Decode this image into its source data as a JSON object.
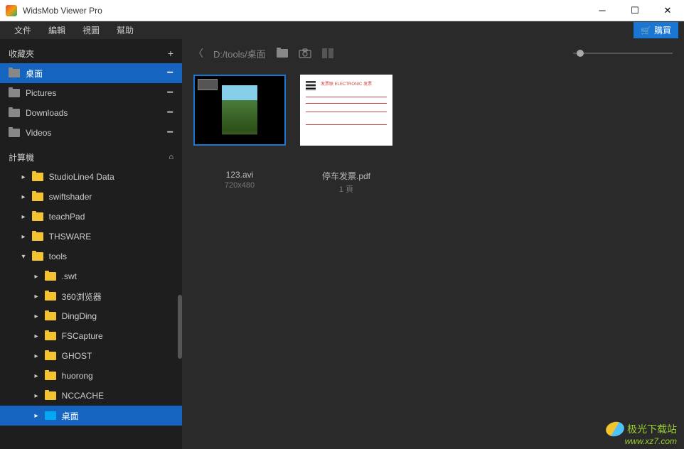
{
  "app": {
    "title": "WidsMob Viewer Pro"
  },
  "menubar": {
    "file": "文件",
    "edit": "編輯",
    "view": "視圖",
    "help": "幫助",
    "buy": "購買"
  },
  "sidebar": {
    "favorites_header": "收藏夾",
    "favorites": [
      {
        "label": "桌面",
        "active": true
      },
      {
        "label": "Pictures",
        "active": false
      },
      {
        "label": "Downloads",
        "active": false
      },
      {
        "label": "Videos",
        "active": false
      }
    ],
    "computer_header": "計算機",
    "tree": [
      {
        "label": "StudioLine4 Data",
        "indent": 1,
        "expanded": false,
        "selected": false,
        "folderType": "yellow"
      },
      {
        "label": "swiftshader",
        "indent": 1,
        "expanded": false,
        "selected": false,
        "folderType": "yellow"
      },
      {
        "label": "teachPad",
        "indent": 1,
        "expanded": false,
        "selected": false,
        "folderType": "yellow"
      },
      {
        "label": "THSWARE",
        "indent": 1,
        "expanded": false,
        "selected": false,
        "folderType": "yellow"
      },
      {
        "label": "tools",
        "indent": 1,
        "expanded": true,
        "selected": false,
        "folderType": "yellow"
      },
      {
        "label": ".swt",
        "indent": 2,
        "expanded": false,
        "selected": false,
        "folderType": "yellow"
      },
      {
        "label": "360浏览器",
        "indent": 2,
        "expanded": false,
        "selected": false,
        "folderType": "yellow"
      },
      {
        "label": "DingDing",
        "indent": 2,
        "expanded": false,
        "selected": false,
        "folderType": "yellow"
      },
      {
        "label": "FSCapture",
        "indent": 2,
        "expanded": false,
        "selected": false,
        "folderType": "yellow"
      },
      {
        "label": "GHOST",
        "indent": 2,
        "expanded": false,
        "selected": false,
        "folderType": "yellow"
      },
      {
        "label": "huorong",
        "indent": 2,
        "expanded": false,
        "selected": false,
        "folderType": "yellow"
      },
      {
        "label": "NCCACHE",
        "indent": 2,
        "expanded": false,
        "selected": false,
        "folderType": "yellow"
      },
      {
        "label": "桌面",
        "indent": 2,
        "expanded": false,
        "selected": true,
        "folderType": "blue"
      }
    ]
  },
  "toolbar": {
    "path": "D:/tools/桌面"
  },
  "thumbnails": [
    {
      "name": "123.avi",
      "info": "720x480",
      "type": "video",
      "selected": true
    },
    {
      "name": "停车发票.pdf",
      "info": "1 頁",
      "type": "pdf",
      "selected": false
    }
  ],
  "watermark": {
    "site_cn": "极光下载站",
    "url": "www.xz7.com"
  }
}
